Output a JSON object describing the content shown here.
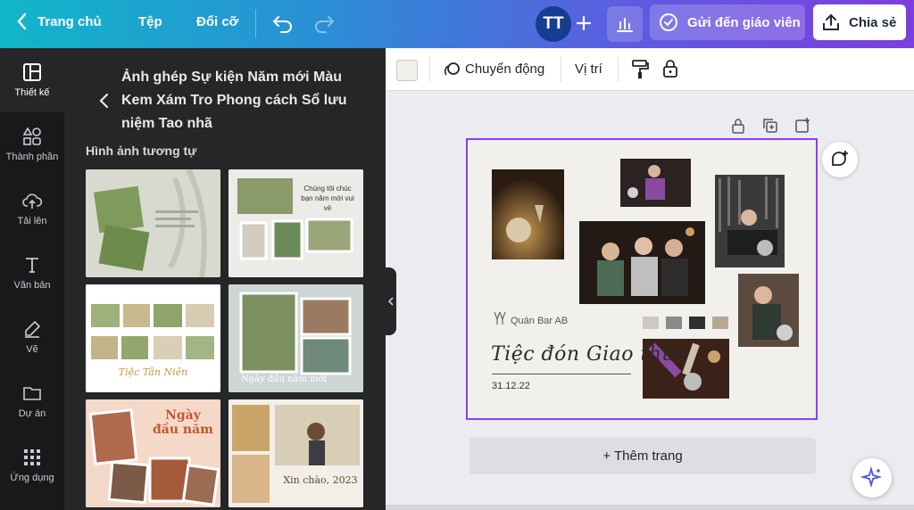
{
  "topbar": {
    "home_label": "Trang chủ",
    "file_label": "Tệp",
    "resize_label": "Đổi cỡ",
    "avatar_initials": "TT",
    "send_label": "Gửi đến giáo viên",
    "share_label": "Chia sẻ"
  },
  "rail": {
    "items": [
      {
        "label": "Thiết kế"
      },
      {
        "label": "Thành phần"
      },
      {
        "label": "Tải lên"
      },
      {
        "label": "Văn bản"
      },
      {
        "label": "Vẽ"
      },
      {
        "label": "Dự án"
      },
      {
        "label": "Ứng dụng"
      }
    ]
  },
  "panel": {
    "title": "Ảnh ghép Sự kiện Năm mới Màu Kem Xám Tro Phong cách Sổ lưu niệm Tao nhã",
    "section_label": "Hình ảnh tương tự",
    "thumbs": [
      {
        "caption": ""
      },
      {
        "caption": "Chúng tôi chúc bạn năm mới vui vẻ"
      },
      {
        "caption": "Tiệc Tân Niên"
      },
      {
        "caption": "Ngày đầu năm mới"
      },
      {
        "caption": "Ngày đầu năm"
      },
      {
        "caption": "Xin chào, 2023"
      }
    ]
  },
  "toolbar": {
    "animate_label": "Chuyển động",
    "position_label": "Vị trí"
  },
  "page": {
    "venue": "Quán Bar AB",
    "title": "Tiệc đón Giao thừa",
    "date": "31.12.22",
    "palette": [
      "#cfc8bf",
      "#8a8a8a",
      "#2f2f2f",
      "#b7a895"
    ]
  },
  "canvas": {
    "add_page_label": "+ Thêm trang"
  },
  "colors": {
    "accent": "#8b3dff",
    "rail_bg": "#18191b",
    "panel_bg": "#252627"
  }
}
